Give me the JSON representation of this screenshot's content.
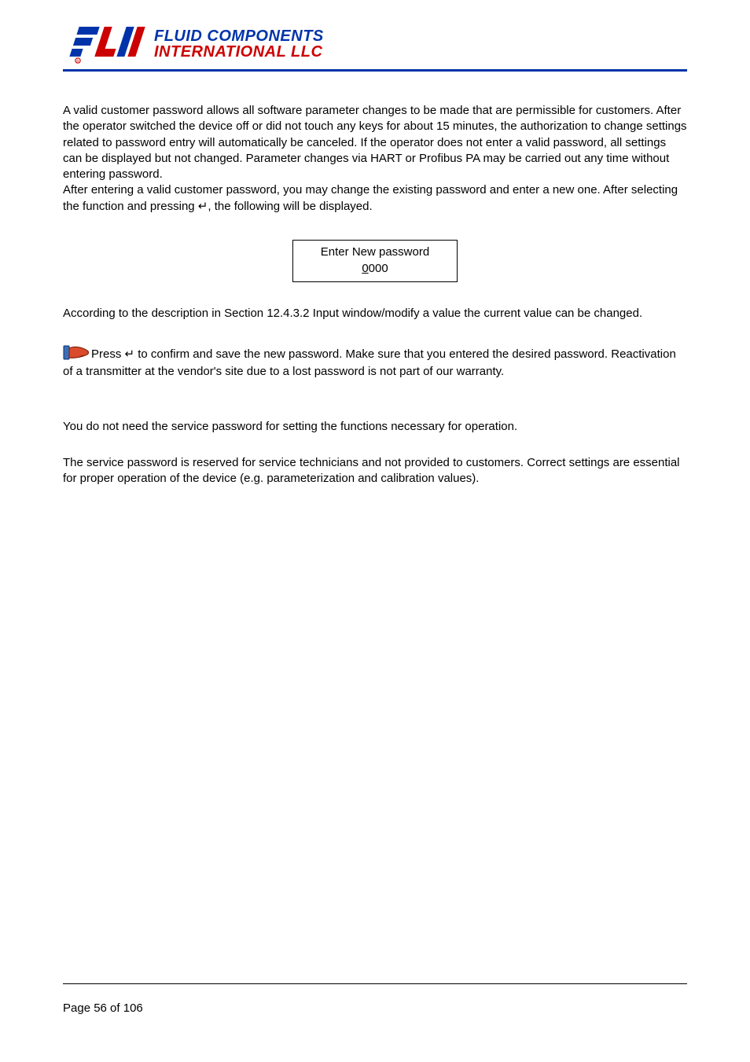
{
  "logo": {
    "line1": "FLUID COMPONENTS",
    "line2": "INTERNATIONAL LLC"
  },
  "para1": "A valid customer password allows all software parameter changes to be made that are permissible for customers. After the operator switched the device off or did not touch any keys for about 15 minutes, the authorization to change settings related to password entry will automatically be canceled. If the operator does not enter a valid password, all settings can be displayed but not changed. Parameter changes via HART or Profibus PA may be carried out any time without entering password.",
  "para2_a": "After entering a valid customer password, you may change the existing password and enter a new one. After selecting the ",
  "para2_b": " function and pressing ↵, the following will be displayed.",
  "display": {
    "line1": "Enter New password",
    "digit_underlined": "0",
    "digits_rest": "000"
  },
  "para3": "According to the description in Section 12.4.3.2 Input window/modify a value the current value can be changed.",
  "note_a": "Press ↵ to confirm and save the new password. Make sure that you entered the desired password. ",
  "note_b": " Reactivation of a transmitter at the vendor's site due to a lost password is not part of our warranty.",
  "para4": "You do not need the service password for setting the functions necessary for operation.",
  "para5": "The service password is reserved for service technicians and not provided to customers. Correct settings are essential for proper operation of the device (e.g. parameterization and calibration values).",
  "footer": "Page 56 of 106"
}
